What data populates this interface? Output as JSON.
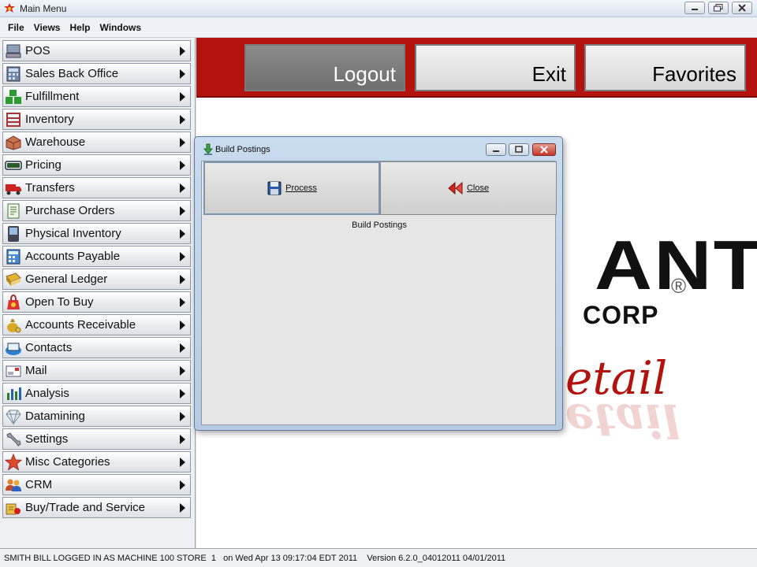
{
  "window": {
    "title": "Main Menu",
    "controls": [
      "minimize-icon",
      "restore-icon",
      "close-icon"
    ]
  },
  "menubar": [
    "File",
    "Views",
    "Help",
    "Windows"
  ],
  "nav": [
    {
      "label": "POS",
      "icon": "pos-terminal-icon"
    },
    {
      "label": "Sales Back Office",
      "icon": "calculator-icon"
    },
    {
      "label": "Fulfillment",
      "icon": "boxes-icon"
    },
    {
      "label": "Inventory",
      "icon": "shelf-icon"
    },
    {
      "label": "Warehouse",
      "icon": "box-icon"
    },
    {
      "label": "Pricing",
      "icon": "price-tag-icon"
    },
    {
      "label": "Transfers",
      "icon": "truck-icon"
    },
    {
      "label": "Purchase Orders",
      "icon": "document-icon"
    },
    {
      "label": "Physical Inventory",
      "icon": "handheld-scanner-icon"
    },
    {
      "label": "Accounts Payable",
      "icon": "calculator-blue-icon"
    },
    {
      "label": "General Ledger",
      "icon": "ledger-book-icon"
    },
    {
      "label": "Open To Buy",
      "icon": "shopping-bag-icon"
    },
    {
      "label": "Accounts Receivable",
      "icon": "money-bag-icon"
    },
    {
      "label": "Contacts",
      "icon": "rolodex-icon"
    },
    {
      "label": "Mail",
      "icon": "envelope-icon"
    },
    {
      "label": "Analysis",
      "icon": "bar-chart-icon"
    },
    {
      "label": "Datamining",
      "icon": "diamond-icon"
    },
    {
      "label": "Settings",
      "icon": "wrench-icon"
    },
    {
      "label": "Misc Categories",
      "icon": "star-icon"
    },
    {
      "label": "CRM",
      "icon": "people-icon"
    },
    {
      "label": "Buy/Trade and Service",
      "icon": "trade-icon"
    }
  ],
  "topbar": {
    "logout": "Logout",
    "exit": "Exit",
    "favorites": "Favorites"
  },
  "logo": {
    "line1": "ANT",
    "registered": "®",
    "line2": "CORP",
    "tagline": "etail"
  },
  "dialog": {
    "title": "Build Postings",
    "process_label": "Process",
    "close_label": "Close",
    "caption": "Build Postings"
  },
  "status": {
    "text": "SMITH BILL LOGGED IN AS MACHINE 100 STORE  1   on Wed Apr 13 09:17:04 EDT 2011    Version 6.2.0_04012011 04/01/2011"
  },
  "colors": {
    "brand_red": "#b4120f",
    "logout_gray": "#7a7a7a"
  }
}
